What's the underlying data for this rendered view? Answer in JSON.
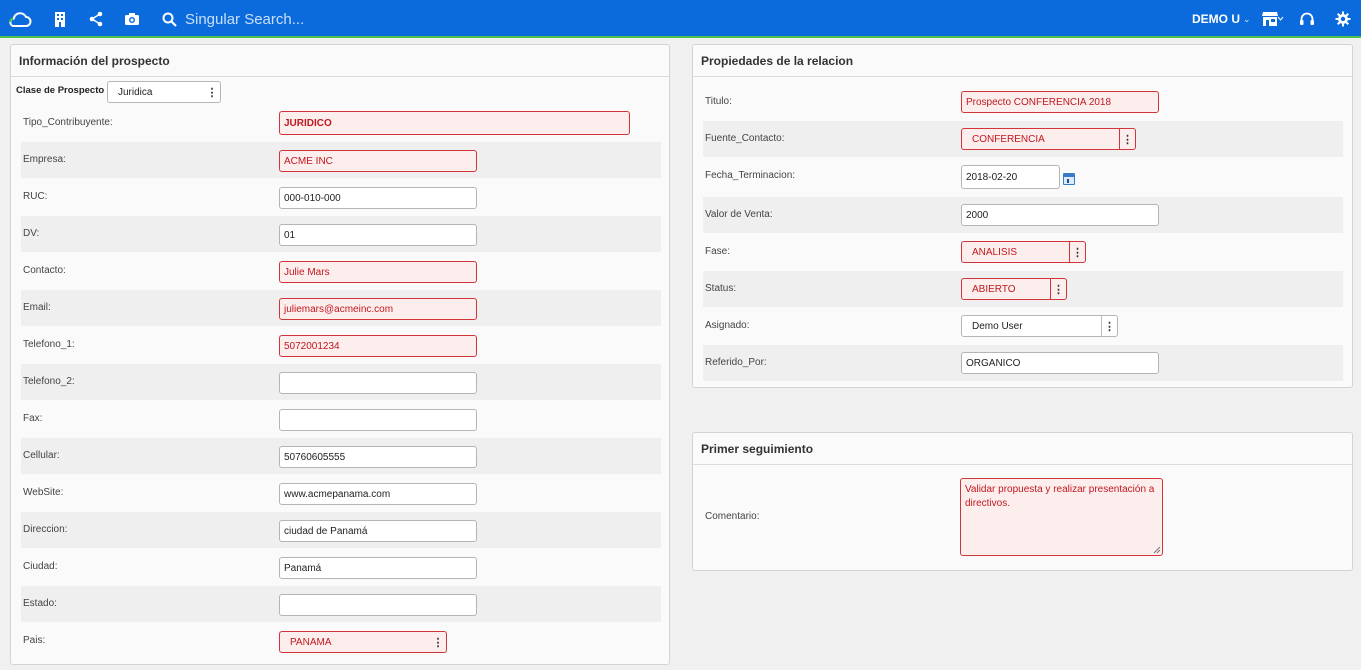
{
  "topbar": {
    "search_placeholder": "Singular Search...",
    "user_label": "DEMO U",
    "chevron": "⌄",
    "icons": [
      "cloud-logo-icon",
      "building-icon",
      "share-icon",
      "camera-icon",
      "search-icon",
      "store-icon",
      "headset-icon",
      "gear-icon"
    ]
  },
  "left_panel": {
    "title": "Información del prospecto",
    "clase_label": "Clase de Prospecto",
    "clase_value": "Juridica",
    "fields": [
      {
        "label": "Tipo_Contribuyente:",
        "value": "JURIDICO"
      },
      {
        "label": "Empresa:",
        "value": "ACME INC"
      },
      {
        "label": "RUC:",
        "value": "000-010-000"
      },
      {
        "label": "DV:",
        "value": "01"
      },
      {
        "label": "Contacto:",
        "value": "Julie Mars"
      },
      {
        "label": "Email:",
        "value": "juliemars@acmeinc.com"
      },
      {
        "label": "Telefono_1:",
        "value": "5072001234"
      },
      {
        "label": "Telefono_2:",
        "value": ""
      },
      {
        "label": "Fax:",
        "value": ""
      },
      {
        "label": "Cellular:",
        "value": "50760605555"
      },
      {
        "label": "WebSite:",
        "value": "www.acmepanama.com"
      },
      {
        "label": "Direccion:",
        "value": "ciudad de Panamá"
      },
      {
        "label": "Ciudad:",
        "value": "Panamá"
      },
      {
        "label": "Estado:",
        "value": ""
      },
      {
        "label": "Pais:",
        "value": "PANAMA"
      }
    ]
  },
  "right_panel": {
    "title": "Propiedades de la relacion",
    "fields": [
      {
        "label": "Titulo:",
        "value": "Prospecto CONFERENCIA 2018"
      },
      {
        "label": "Fuente_Contacto:",
        "value": "CONFERENCIA"
      },
      {
        "label": "Fecha_Terminacion:",
        "value": "2018-02-20"
      },
      {
        "label": "Valor de Venta:",
        "value": "2000"
      },
      {
        "label": "Fase:",
        "value": "ANALISIS"
      },
      {
        "label": "Status:",
        "value": "ABIERTO"
      },
      {
        "label": "Asignado:",
        "value": "Demo User"
      },
      {
        "label": "Referido_Por:",
        "value": "ORGANICO"
      }
    ]
  },
  "followup_panel": {
    "title": "Primer seguimiento",
    "comment_label": "Comentario:",
    "comment_value": "Validar propuesta y realizar presentación a directivos."
  },
  "colors": {
    "topbar": "#0b6bdc",
    "topbar_underline": "#4cc14a",
    "required_border": "#d0353a",
    "required_fill": "#fdeeee",
    "required_text": "#c0181f"
  }
}
